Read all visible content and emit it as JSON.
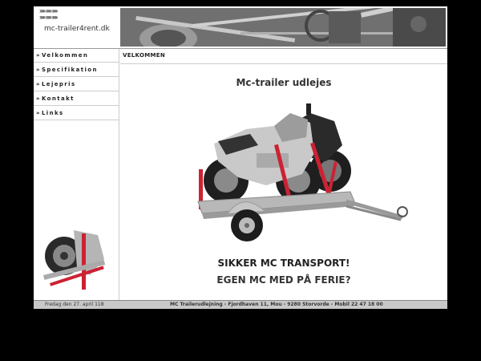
{
  "header": {
    "logo_text": "mc-trailer4rent.dk"
  },
  "sidebar": {
    "items": [
      {
        "label": "Velkommen"
      },
      {
        "label": "Specifikation"
      },
      {
        "label": "Lejepris"
      },
      {
        "label": "Kontakt"
      },
      {
        "label": "Links"
      }
    ],
    "arrow": "»"
  },
  "main": {
    "breadcrumb": "VELKOMMEN",
    "title": "Mc-trailer udlejes",
    "tagline1": "SIKKER MC TRANSPORT!",
    "tagline2": "EGEN MC MED PÅ FERIE?"
  },
  "footer": {
    "date": "Fredag den 27. april 118",
    "address": "MC Trailerudlejning - Fjordhaven 11, Mou - 9280 Storvorde - Mobil 22 47 18 00"
  },
  "colors": {
    "background": "#000000",
    "page": "#ffffff",
    "strap_red": "#cc2233",
    "footer_bar": "#c8c8c8"
  }
}
